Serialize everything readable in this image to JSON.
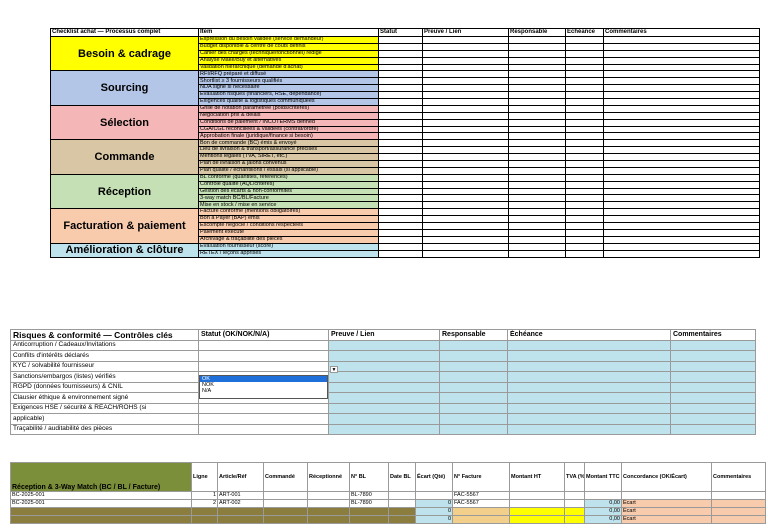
{
  "checklist": {
    "header": [
      "Checklist achat — Processus complet",
      "Item",
      "Statut",
      "Preuve / Lien",
      "Responsable",
      "Échéance",
      "Commentaires"
    ],
    "sections": [
      {
        "name": "Besoin & cadrage",
        "color": "#ffff00",
        "items": [
          "Expression du besoin validée (service demandeur)",
          "Budget disponible & centre de coûts définis",
          "Cahier des charges (technique/fonctionnel) rédigé",
          "Analyse Make/Buy et alternatives",
          "Validation hiérarchique (demande d'achat)"
        ]
      },
      {
        "name": "Sourcing",
        "color": "#b4c6e7",
        "items": [
          "RFI/RFQ préparé et diffusé",
          "Shortlist ≥ 3 fournisseurs qualifiés",
          "NDA signé si nécessaire",
          "Évaluation risques (financiers, RSE, dépendance)",
          "Exigences qualité & logistiques communiquées"
        ]
      },
      {
        "name": "Sélection",
        "color": "#f4b6b6",
        "items": [
          "Grille de notation paramétrée (poids/critères)",
          "Négociation prix & délais",
          "Conditions de paiement / INCOTERMS defined",
          "CGA/CGL réconciliées & validées (contrat/ordre)",
          "Approbation finale (juridique/finance si besoin)"
        ]
      },
      {
        "name": "Commande",
        "color": "#d9c6a5",
        "items": [
          "Bon de commande (BC) émis & envoyé",
          "Lieu de livraison & transport/assurance précisés",
          "Mentions légales (TVA, SIRET, etc.)",
          "Plan de livraison & jalons convenus",
          "Plan qualité / échantillons / essais (si applicable)"
        ]
      },
      {
        "name": "Réception",
        "color": "#c5e0b4",
        "items": [
          "BL conforme (quantités, références)",
          "Contrôle qualité (AQL/critères)",
          "Gestion des écarts & non-conformités",
          "3-way match BC/BL/Facture",
          "Mise en stock / mise en service"
        ]
      },
      {
        "name": "Facturation & paiement",
        "color": "#f8cbad",
        "items": [
          "Facture conforme (mentions obligatoires)",
          "Bon à Payer (BAP) émis",
          "Escompte négocié / conditions respectées",
          "Paiement exécuté",
          "Archivage & traçabilité des pièces"
        ]
      },
      {
        "name": "Amélioration & clôture",
        "color": "#bfe3ec",
        "items": [
          "Évaluation fournisseur (score)",
          "RETEX / leçons apprises"
        ]
      }
    ]
  },
  "risks": {
    "header": [
      "Risques & conformité — Contrôles clés",
      "Statut (OK/NOK/N/A)",
      "Preuve / Lien",
      "Responsable",
      "Échéance",
      "Commentaires"
    ],
    "rows": [
      "Anticorruption / Cadeaux/Invitations",
      "Conflits d'intérêts déclarés",
      "KYC / solvabilité fournisseur",
      "Sanctions/embargos (listes) vérifiés",
      "RGPD (données fournisseurs) & CNIL",
      "Clausier éthique & environnement signé",
      "Exigences HSE / sécurité & REACH/ROHS (si",
      "applicable)",
      "Traçabilité / auditabilité des pièces"
    ],
    "dropdown": {
      "options": [
        "OK",
        "NOK",
        "N/A"
      ],
      "selected": "OK"
    }
  },
  "match": {
    "header": [
      "Réception & 3-Way Match (BC / BL / Facture)",
      "Ligne",
      "Article/Réf",
      "Commandé",
      "Réceptionné",
      "N° BL",
      "Date BL",
      "Écart (Qté)",
      "N° Facture",
      "Montant HT",
      "TVA (%)",
      "Montant TTC",
      "Concordance (OK/Écart)",
      "Commentaires"
    ],
    "rows": [
      {
        "bc": "BC-2025-001",
        "ligne": "1",
        "article": "ART-001",
        "bl": "BL-7890",
        "ecart": "",
        "facture": "FAC-5567",
        "ttc": "",
        "conc": ""
      },
      {
        "bc": "BC-2025-001",
        "ligne": "2",
        "article": "ART-002",
        "bl": "BL-7890",
        "ecart": "0",
        "facture": "FAC-5567",
        "ttc": "0,00",
        "conc": "Écart"
      },
      {
        "bc": "",
        "ligne": "",
        "article": "",
        "bl": "",
        "ecart": "0",
        "facture": "",
        "ttc": "0,00",
        "conc": "Écart"
      },
      {
        "bc": "",
        "ligne": "",
        "article": "",
        "bl": "",
        "ecart": "0",
        "facture": "",
        "ttc": "0,00",
        "conc": "Écart"
      }
    ]
  }
}
